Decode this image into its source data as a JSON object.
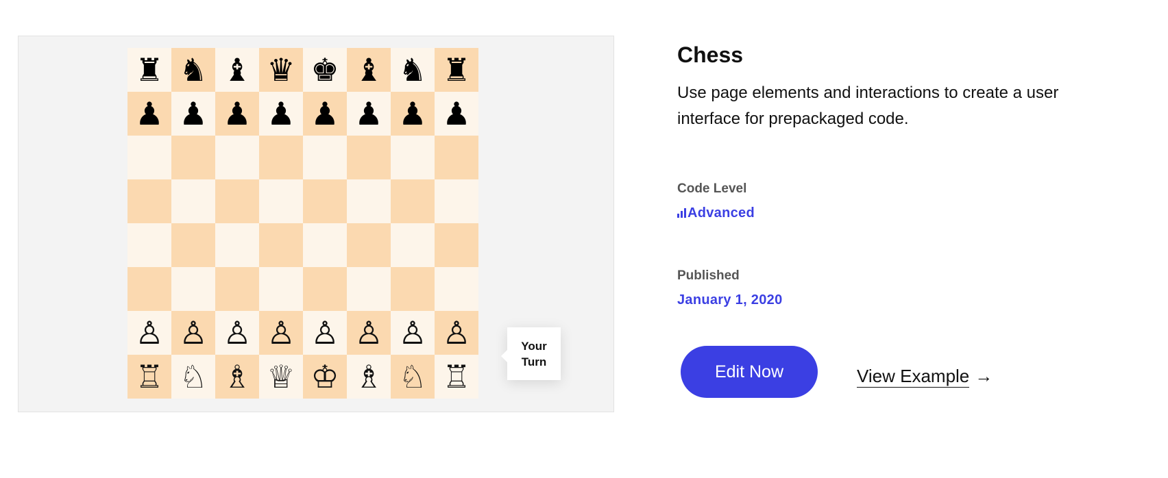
{
  "preview": {
    "board": [
      [
        "♜",
        "♞",
        "♝",
        "♛",
        "♚",
        "♝",
        "♞",
        "♜"
      ],
      [
        "♟",
        "♟",
        "♟",
        "♟",
        "♟",
        "♟",
        "♟",
        "♟"
      ],
      [
        "",
        "",
        "",
        "",
        "",
        "",
        "",
        ""
      ],
      [
        "",
        "",
        "",
        "",
        "",
        "",
        "",
        ""
      ],
      [
        "",
        "",
        "",
        "",
        "",
        "",
        "",
        ""
      ],
      [
        "",
        "",
        "",
        "",
        "",
        "",
        "",
        ""
      ],
      [
        "♙",
        "♙",
        "♙",
        "♙",
        "♙",
        "♙",
        "♙",
        "♙"
      ],
      [
        "♖",
        "♘",
        "♗",
        "♕",
        "♔",
        "♗",
        "♘",
        "♖"
      ]
    ],
    "light_color": "#fdf5ea",
    "dark_color": "#fbd9b0",
    "turn_label": "Your Turn"
  },
  "info": {
    "title": "Chess",
    "description": "Use page elements and interactions to create a user interface for prepackaged code.",
    "code_level_label": "Code Level",
    "code_level_value": "Advanced",
    "code_level_icon": "signal-bars-icon",
    "published_label": "Published",
    "published_value": "January 1, 2020",
    "accent_color": "#3b3fe3",
    "edit_button": "Edit Now",
    "view_link": "View Example",
    "view_link_icon": "arrow-right-icon"
  }
}
